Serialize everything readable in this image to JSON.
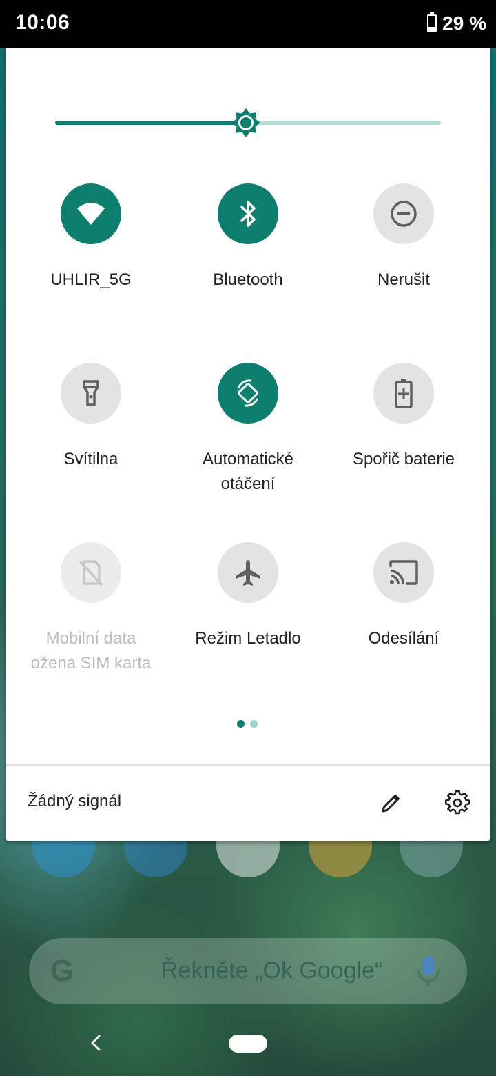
{
  "status_bar": {
    "time": "10:06",
    "battery_percent": "29 %",
    "battery_level": 0.29
  },
  "brightness": {
    "level": 0.495
  },
  "tiles": [
    {
      "label": "UHLIR_5G",
      "state": "on",
      "icon": "wifi-icon"
    },
    {
      "label": "Bluetooth",
      "state": "on",
      "icon": "bluetooth-icon"
    },
    {
      "label": "Nerušit",
      "state": "off",
      "icon": "do-not-disturb-icon"
    },
    {
      "label": "Svítilna",
      "state": "off",
      "icon": "flashlight-icon"
    },
    {
      "label": "Automatické",
      "sub": "otáčení",
      "state": "on",
      "icon": "auto-rotate-icon"
    },
    {
      "label": "Spořič baterie",
      "state": "off",
      "icon": "battery-saver-icon"
    },
    {
      "label": "Mobilní data",
      "sub": "ožena SIM karta",
      "state": "disabled",
      "icon": "no-sim-icon"
    },
    {
      "label": "Režim Letadlo",
      "state": "off",
      "icon": "airplane-icon"
    },
    {
      "label": "Odesílání",
      "state": "off",
      "icon": "cast-icon"
    }
  ],
  "pager": {
    "pages": 2,
    "current": 1
  },
  "footer": {
    "carrier_text": "Žádný signál"
  },
  "search": {
    "placeholder": "Řekněte „Ok Google“",
    "logo": "G"
  },
  "colors": {
    "accent": "#0e7e6e",
    "tile_off": "#e3e3e3",
    "panel_bg": "#ffffff"
  }
}
